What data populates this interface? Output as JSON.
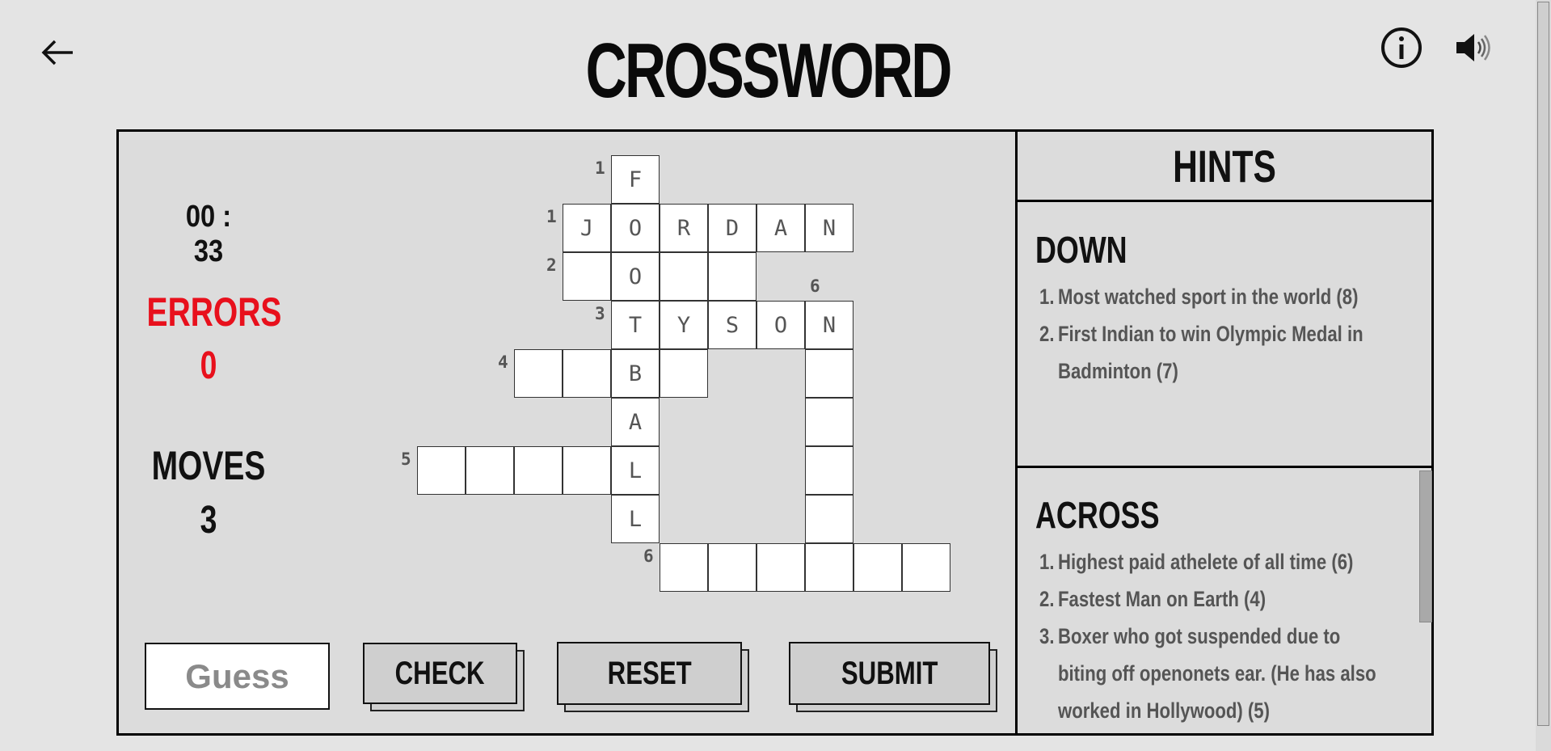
{
  "header": {
    "title": "CROSSWORD",
    "back_icon": "arrow-left-icon",
    "info_icon": "info-circle-icon",
    "sound_icon": "speaker-icon"
  },
  "stats": {
    "timer": "00 : 33",
    "errors_label": "ERRORS",
    "errors_value": "0",
    "moves_label": "MOVES",
    "moves_value": "3"
  },
  "grid": {
    "cells": [
      {
        "r": 0,
        "c": 4,
        "v": "F"
      },
      {
        "r": 1,
        "c": 3,
        "v": "J"
      },
      {
        "r": 1,
        "c": 4,
        "v": "O"
      },
      {
        "r": 1,
        "c": 5,
        "v": "R"
      },
      {
        "r": 1,
        "c": 6,
        "v": "D"
      },
      {
        "r": 1,
        "c": 7,
        "v": "A"
      },
      {
        "r": 1,
        "c": 8,
        "v": "N"
      },
      {
        "r": 2,
        "c": 3,
        "v": ""
      },
      {
        "r": 2,
        "c": 4,
        "v": "O"
      },
      {
        "r": 2,
        "c": 5,
        "v": ""
      },
      {
        "r": 2,
        "c": 6,
        "v": ""
      },
      {
        "r": 3,
        "c": 4,
        "v": "T"
      },
      {
        "r": 3,
        "c": 5,
        "v": "Y"
      },
      {
        "r": 3,
        "c": 6,
        "v": "S"
      },
      {
        "r": 3,
        "c": 7,
        "v": "O"
      },
      {
        "r": 3,
        "c": 8,
        "v": "N"
      },
      {
        "r": 4,
        "c": 2,
        "v": ""
      },
      {
        "r": 4,
        "c": 3,
        "v": ""
      },
      {
        "r": 4,
        "c": 4,
        "v": "B"
      },
      {
        "r": 4,
        "c": 5,
        "v": ""
      },
      {
        "r": 4,
        "c": 8,
        "v": ""
      },
      {
        "r": 5,
        "c": 4,
        "v": "A"
      },
      {
        "r": 5,
        "c": 8,
        "v": ""
      },
      {
        "r": 6,
        "c": 0,
        "v": ""
      },
      {
        "r": 6,
        "c": 1,
        "v": ""
      },
      {
        "r": 6,
        "c": 2,
        "v": ""
      },
      {
        "r": 6,
        "c": 3,
        "v": ""
      },
      {
        "r": 6,
        "c": 4,
        "v": "L"
      },
      {
        "r": 6,
        "c": 8,
        "v": ""
      },
      {
        "r": 7,
        "c": 4,
        "v": "L"
      },
      {
        "r": 7,
        "c": 8,
        "v": ""
      },
      {
        "r": 8,
        "c": 5,
        "v": ""
      },
      {
        "r": 8,
        "c": 6,
        "v": ""
      },
      {
        "r": 8,
        "c": 7,
        "v": ""
      },
      {
        "r": 8,
        "c": 8,
        "v": ""
      },
      {
        "r": 8,
        "c": 9,
        "v": ""
      },
      {
        "r": 8,
        "c": 10,
        "v": ""
      }
    ],
    "numbers": [
      {
        "r": 0,
        "c": 4,
        "n": "1",
        "side": "left"
      },
      {
        "r": 1,
        "c": 3,
        "n": "1",
        "side": "left"
      },
      {
        "r": 2,
        "c": 3,
        "n": "2",
        "side": "left"
      },
      {
        "r": 3,
        "c": 4,
        "n": "3",
        "side": "left"
      },
      {
        "r": 3,
        "c": 8,
        "n": "6",
        "side": "top"
      },
      {
        "r": 4,
        "c": 2,
        "n": "4",
        "side": "left"
      },
      {
        "r": 6,
        "c": 0,
        "n": "5",
        "side": "left"
      },
      {
        "r": 8,
        "c": 5,
        "n": "6",
        "side": "left"
      }
    ]
  },
  "controls": {
    "guess_placeholder": "Guess",
    "check_label": "CHECK",
    "reset_label": "RESET",
    "submit_label": "SUBMIT"
  },
  "hints": {
    "title": "HINTS",
    "down_title": "DOWN",
    "down": [
      {
        "n": "1.",
        "lines": [
          "Most watched sport in the world (8)"
        ]
      },
      {
        "n": "2.",
        "lines": [
          "First Indian to win Olympic Medal in",
          "Badminton (7)"
        ]
      }
    ],
    "across_title": "ACROSS",
    "across": [
      {
        "n": "1.",
        "lines": [
          "Highest paid athelete of all time (6)"
        ]
      },
      {
        "n": "2.",
        "lines": [
          "Fastest Man on Earth (4)"
        ]
      },
      {
        "n": "3.",
        "lines": [
          "Boxer who got suspended due to",
          "biting off openonets ear. (He has also",
          "worked in Hollywood) (5)"
        ]
      }
    ]
  }
}
